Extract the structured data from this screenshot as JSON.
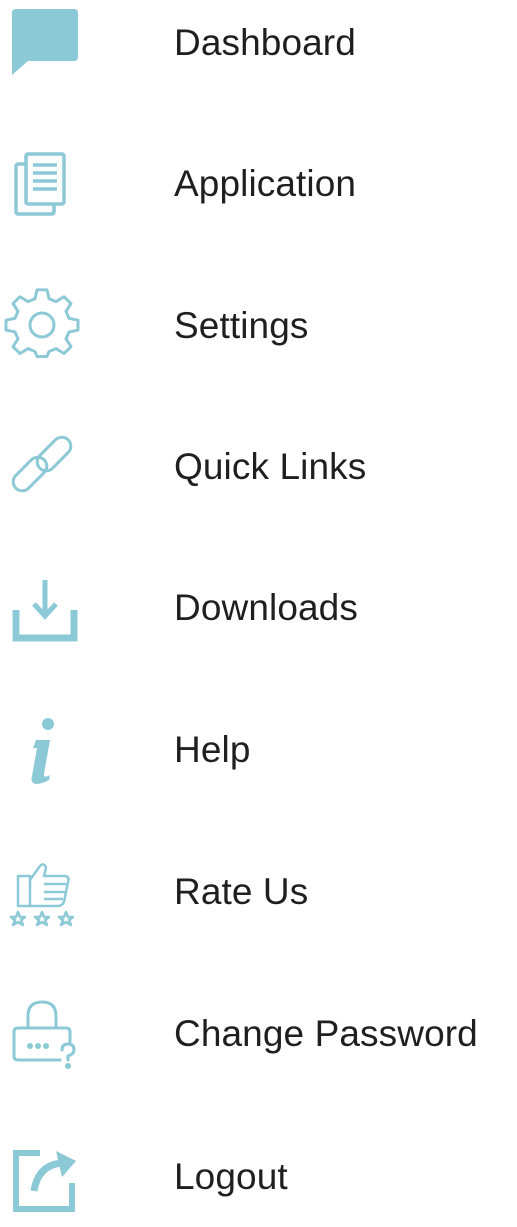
{
  "accent_color": "#8cc9d6",
  "menu": {
    "items": [
      {
        "label": "Dashboard",
        "icon": "speech-bubble-icon"
      },
      {
        "label": "Application",
        "icon": "documents-icon"
      },
      {
        "label": "Settings",
        "icon": "gear-icon"
      },
      {
        "label": "Quick Links",
        "icon": "link-icon"
      },
      {
        "label": "Downloads",
        "icon": "download-icon"
      },
      {
        "label": "Help",
        "icon": "info-icon"
      },
      {
        "label": "Rate Us",
        "icon": "thumbs-up-stars-icon"
      },
      {
        "label": "Change Password",
        "icon": "padlock-question-icon"
      },
      {
        "label": "Logout",
        "icon": "share-arrow-icon"
      }
    ]
  }
}
